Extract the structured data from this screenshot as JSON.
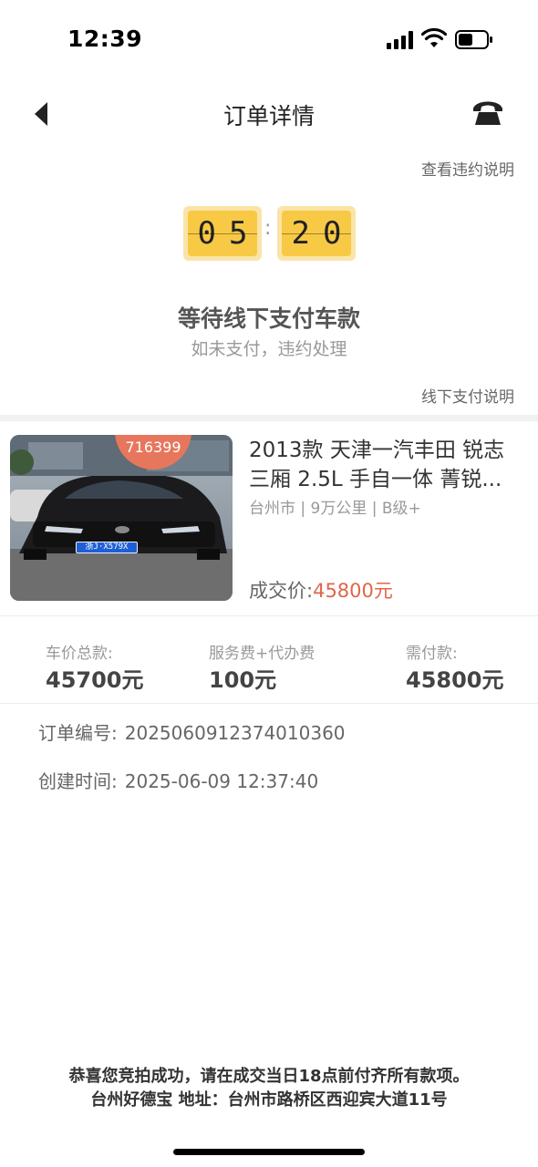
{
  "status_bar": {
    "time": "12:39"
  },
  "nav": {
    "title": "订单详情"
  },
  "links": {
    "violation": "查看违约说明",
    "offline_pay": "线下支付说明"
  },
  "countdown": {
    "minutes_d1": "0",
    "minutes_d2": "5",
    "seconds_d1": "2",
    "seconds_d2": "0",
    "separator": ":"
  },
  "status": {
    "title": "等待线下支付车款",
    "subtitle": "如未支付，违约处理"
  },
  "car": {
    "badge": "716399",
    "plate": "浙J·X579X",
    "title_line1": "2013款 天津一汽丰田 锐志",
    "title_line2": "三厢 2.5L 手自一体 菁锐...",
    "meta": "台州市 | 9万公里 | B级+",
    "deal_label": "成交价:",
    "deal_price": "45800元"
  },
  "fees": [
    {
      "label": "车价总款:",
      "value": "45700元"
    },
    {
      "label": "服务费+代办费",
      "value": "100元"
    },
    {
      "label": "需付款:",
      "value": "45800元"
    }
  ],
  "order": {
    "number_label": "订单编号:",
    "number": "2025060912374010360",
    "created_label": "创建时间:",
    "created": "2025-06-09 12:37:40"
  },
  "footer": {
    "line1": "恭喜您竞拍成功，请在成交当日18点前付齐所有款项。",
    "line2": "台州好德宝 地址：台州市路桥区西迎宾大道11号"
  },
  "colors": {
    "accent": "#e0664a",
    "timer_bg": "#f7c945",
    "timer_outer": "#fbe4a8"
  }
}
